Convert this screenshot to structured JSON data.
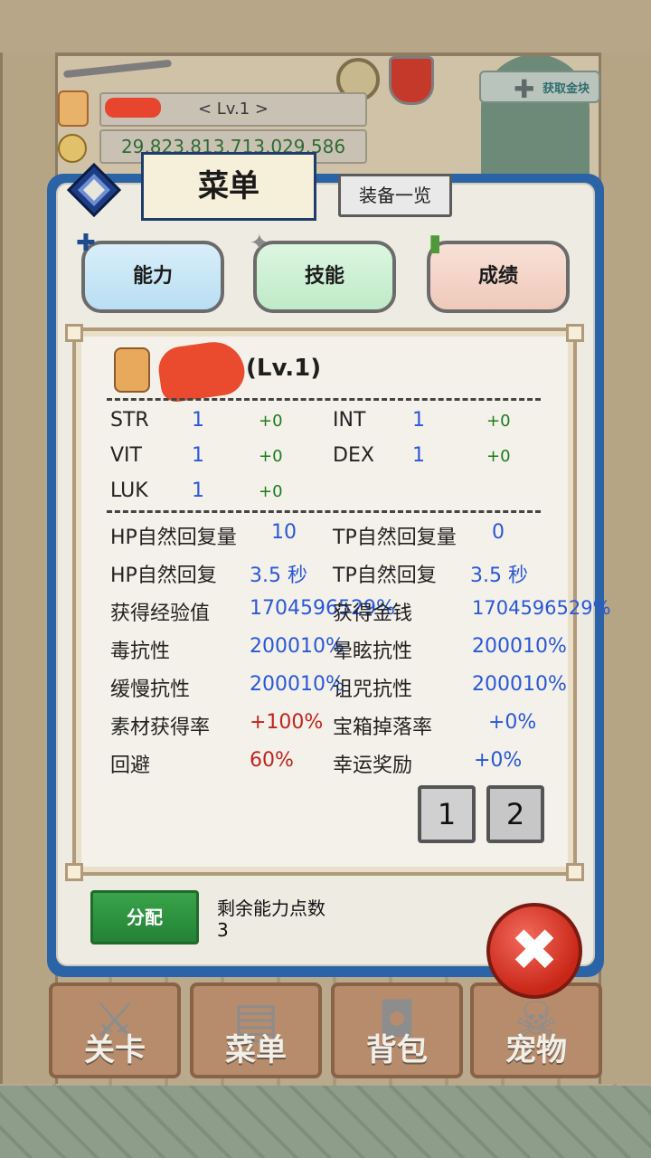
{
  "hud": {
    "level": "< Lv.1 >",
    "gold": "29,823,813,713,029,586",
    "get_gold_label": "获取金块"
  },
  "dialog": {
    "title": "菜单",
    "equip_list_label": "装备一览",
    "tabs": [
      {
        "label": "能力",
        "icon": "person-plus-icon"
      },
      {
        "label": "技能",
        "icon": "sparkle-icon"
      },
      {
        "label": "成绩",
        "icon": "scroll-icon"
      }
    ],
    "character_level": "(Lv.1)",
    "base_stats": [
      {
        "name": "STR",
        "value": "1",
        "bonus": "+0"
      },
      {
        "name": "INT",
        "value": "1",
        "bonus": "+0"
      },
      {
        "name": "VIT",
        "value": "1",
        "bonus": "+0"
      },
      {
        "name": "DEX",
        "value": "1",
        "bonus": "+0"
      },
      {
        "name": "LUK",
        "value": "1",
        "bonus": "+0"
      }
    ],
    "detail_stats": [
      {
        "name": "HP自然回复量",
        "value": "10"
      },
      {
        "name": "TP自然回复量",
        "value": "0"
      },
      {
        "name": "HP自然回复",
        "value": "3.5 秒"
      },
      {
        "name": "TP自然回复",
        "value": "3.5 秒"
      },
      {
        "name": "获得经验值",
        "value": "1704596529%"
      },
      {
        "name": "获得金钱",
        "value": "1704596529%"
      },
      {
        "name": "毒抗性",
        "value": "200010%"
      },
      {
        "name": "晕眩抗性",
        "value": "200010%"
      },
      {
        "name": "缓慢抗性",
        "value": "200010%"
      },
      {
        "name": "诅咒抗性",
        "value": "200010%"
      },
      {
        "name": "素材获得率",
        "value": "+100%"
      },
      {
        "name": "宝箱掉落率",
        "value": "+0%"
      },
      {
        "name": "回避",
        "value": "60%"
      },
      {
        "name": "幸运奖励",
        "value": "+0%"
      }
    ],
    "pages": [
      "1",
      "2"
    ],
    "allocate_label": "分配",
    "remaining_points_label": "剩余能力点数",
    "remaining_points": "3"
  },
  "nav": [
    {
      "label": "关卡",
      "icon": "crossed-swords-icon"
    },
    {
      "label": "菜单",
      "icon": "book-icon"
    },
    {
      "label": "背包",
      "icon": "backpack-icon"
    },
    {
      "label": "宠物",
      "icon": "pet-skull-icon"
    }
  ]
}
